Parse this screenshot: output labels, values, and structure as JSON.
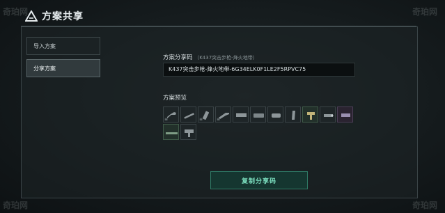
{
  "window": {
    "title": "方案共享"
  },
  "nav": {
    "items": [
      {
        "label": "导入方案",
        "active": false
      },
      {
        "label": "分享方案",
        "active": true
      }
    ]
  },
  "share_code": {
    "label": "方案分享码",
    "sublabel": "（K437突击步枪-烽火地带）",
    "value": "K437突击步枪-烽火地带-6G34ELK0F1LE2F5RPVC75"
  },
  "preview": {
    "label": "方案预览",
    "slots": [
      {
        "icon": "stock-icon",
        "tag": "≡",
        "variant": "default"
      },
      {
        "icon": "barrel-icon",
        "tag": "",
        "variant": "default"
      },
      {
        "icon": "muzzle-icon",
        "tag": "≡",
        "variant": "default"
      },
      {
        "icon": "handguard-icon",
        "tag": "≡",
        "variant": "default"
      },
      {
        "icon": "rail-icon",
        "tag": "",
        "variant": "default"
      },
      {
        "icon": "scope-mount-icon",
        "tag": "",
        "variant": "default"
      },
      {
        "icon": "scope-icon",
        "tag": "",
        "variant": "default"
      },
      {
        "icon": "magazine-icon",
        "tag": "",
        "variant": "default"
      },
      {
        "icon": "grip-icon",
        "tag": "",
        "variant": "green"
      },
      {
        "icon": "laser-icon",
        "tag": "",
        "variant": "default"
      },
      {
        "icon": "optic-icon",
        "tag": "",
        "variant": "purple"
      },
      {
        "icon": "rail-cover-icon",
        "tag": "",
        "variant": "green"
      },
      {
        "icon": "foregrip-icon",
        "tag": "",
        "variant": "default"
      }
    ]
  },
  "actions": {
    "copy_label": "复制分享码"
  },
  "watermark": {
    "text": "奇珀网"
  },
  "colors": {
    "accent": "#2f7a66",
    "accent_text": "#7de0c0",
    "background": "#0f1416"
  }
}
